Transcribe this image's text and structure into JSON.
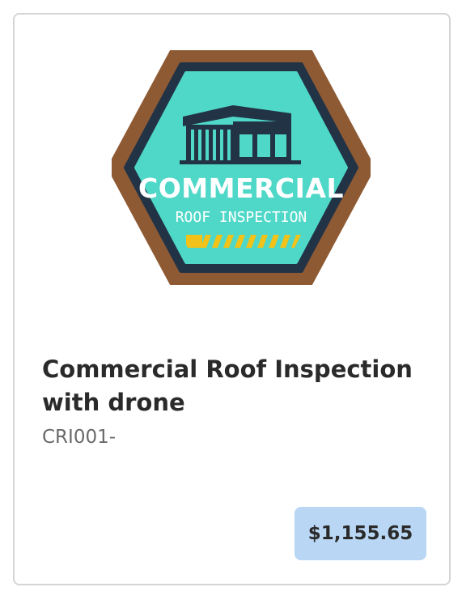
{
  "product": {
    "badge": {
      "line1": "COMMERCIAL",
      "line2": "ROOF INSPECTION",
      "colors": {
        "outer_rim": "#8e5a34",
        "dark_border": "#233346",
        "face": "#4fd8c8",
        "stripe_yellow": "#f2c218"
      }
    },
    "title": "Commercial Roof Inspection with drone",
    "sku": "CRI001-",
    "price": "$1,155.65"
  }
}
